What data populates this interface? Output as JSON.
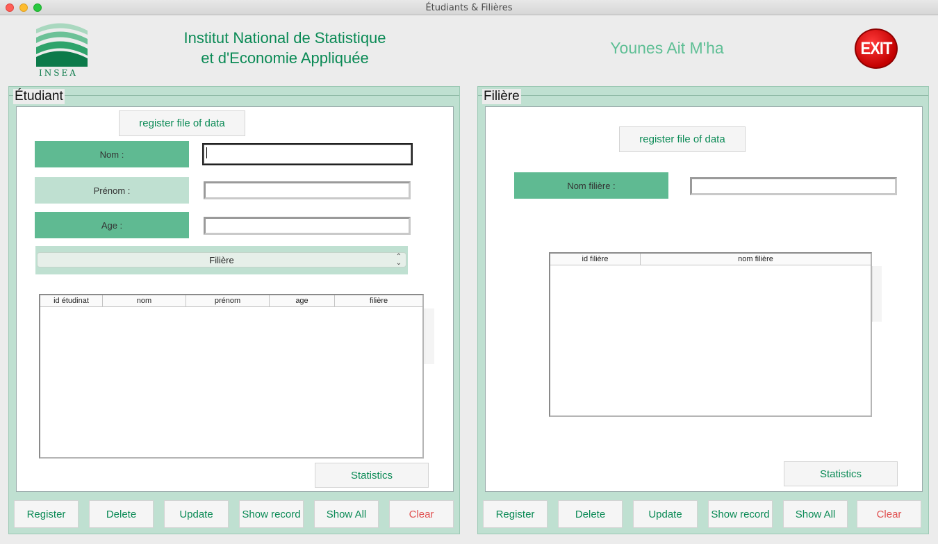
{
  "window": {
    "title": "Étudiants & Filières"
  },
  "header": {
    "logo_text": "INSEA",
    "institute_line1": "Institut National de Statistique",
    "institute_line2": "et d'Economie Appliquée",
    "author": "Younes Ait M'ha",
    "exit_label": "EXIT"
  },
  "etudiant": {
    "legend": "Étudiant",
    "register_file": "register file of data",
    "nom_label": "Nom :",
    "prenom_label": "Prénom :",
    "age_label": "Age :",
    "nom_value": "",
    "prenom_value": "",
    "age_value": "",
    "filiere_select": "Filière",
    "table_columns": [
      "id étudinat",
      "nom",
      "prénom",
      "age",
      "filière"
    ],
    "statistics": "Statistics",
    "buttons": {
      "register": "Register",
      "delete": "Delete",
      "update": "Update",
      "show_record": "Show record",
      "show_all": "Show All",
      "clear": "Clear"
    }
  },
  "filiere": {
    "legend": "Filière",
    "register_file": "register file of data",
    "nom_filiere_label": "Nom filière :",
    "nom_filiere_value": "",
    "table_columns": [
      "id filière",
      "nom filière"
    ],
    "statistics": "Statistics",
    "buttons": {
      "register": "Register",
      "delete": "Delete",
      "update": "Update",
      "show_record": "Show record",
      "show_all": "Show All",
      "clear": "Clear"
    }
  },
  "colors": {
    "accent": "#0a8a55",
    "label_dark": "#5fba92",
    "label_light": "#bfe0d1",
    "danger": "#e05050",
    "exit": "#d40000"
  }
}
